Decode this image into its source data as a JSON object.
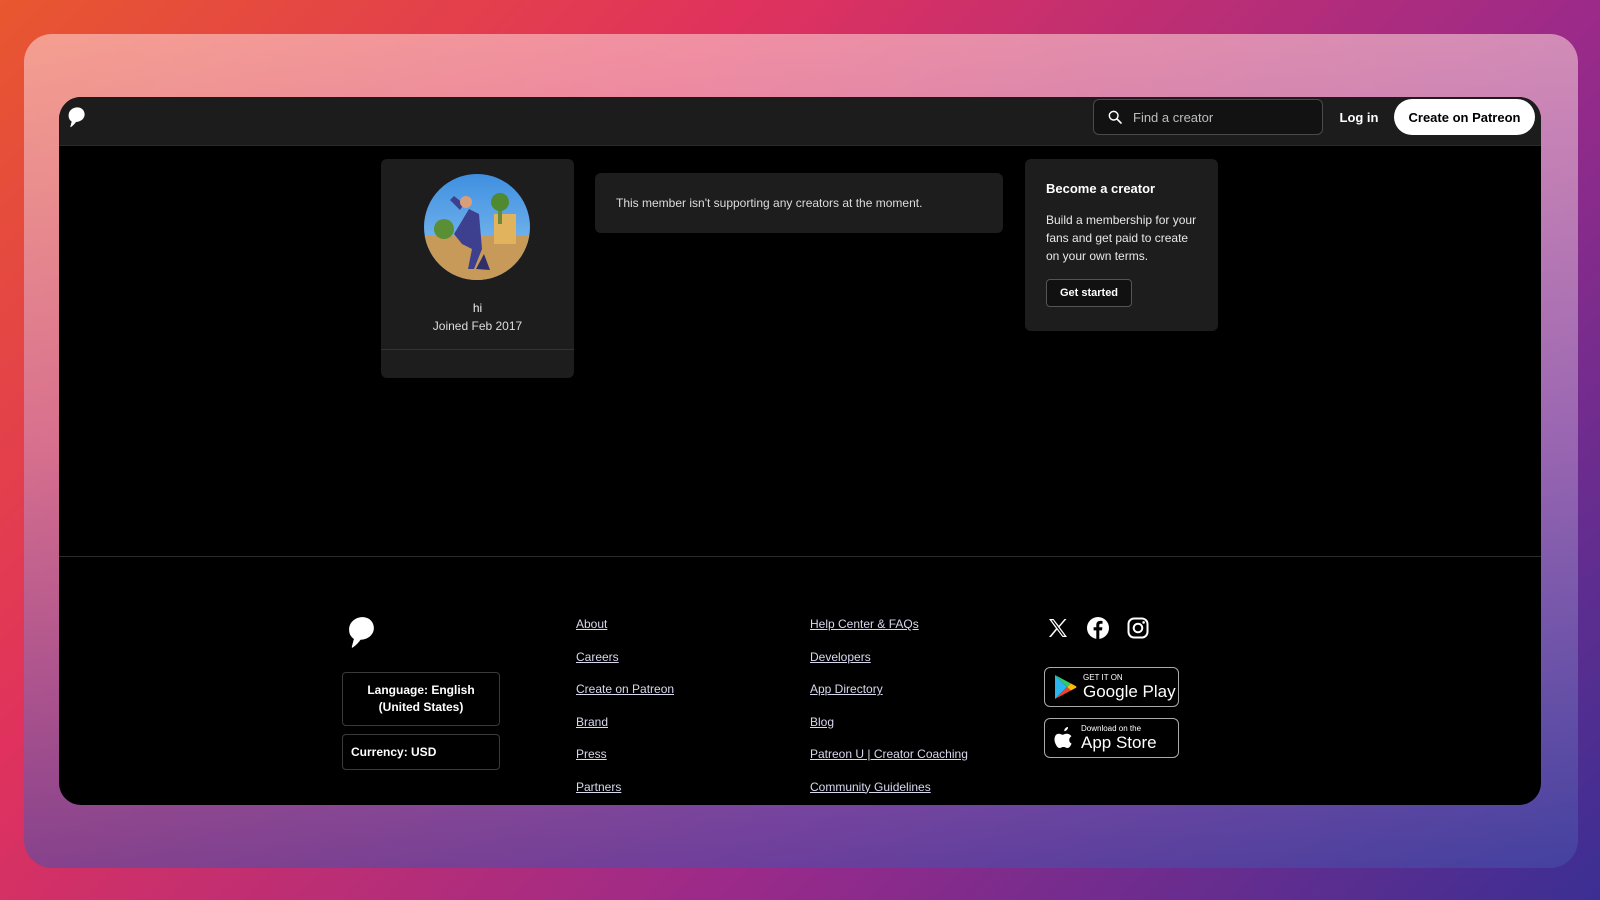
{
  "header": {
    "search_placeholder": "Find a creator",
    "login_label": "Log in",
    "create_label": "Create on Patreon"
  },
  "profile": {
    "name": "hi",
    "joined": "Joined Feb 2017"
  },
  "supporting": {
    "message": "This member isn't supporting any creators at the moment."
  },
  "creator_promo": {
    "title": "Become a creator",
    "body": "Build a membership for your fans and get paid to create on your own terms.",
    "button_label": "Get started"
  },
  "footer": {
    "language_label": "Language: English (United States)",
    "currency_label": "Currency: USD",
    "col1": [
      "About",
      "Careers",
      "Create on Patreon",
      "Brand",
      "Press",
      "Partners"
    ],
    "col2": [
      "Help Center & FAQs",
      "Developers",
      "App Directory",
      "Blog",
      "Patreon U | Creator Coaching",
      "Community Guidelines"
    ],
    "social": [
      "x-icon",
      "facebook-icon",
      "instagram-icon"
    ],
    "google_play": {
      "small": "GET IT ON",
      "big": "Google Play"
    },
    "app_store": {
      "small": "Download on the",
      "big": "App Store"
    }
  },
  "colors": {
    "window_bg": "#000000",
    "card_bg": "#1d1d1d",
    "topbar_bg": "#1c1c1c",
    "link": "#d8d8ee"
  }
}
